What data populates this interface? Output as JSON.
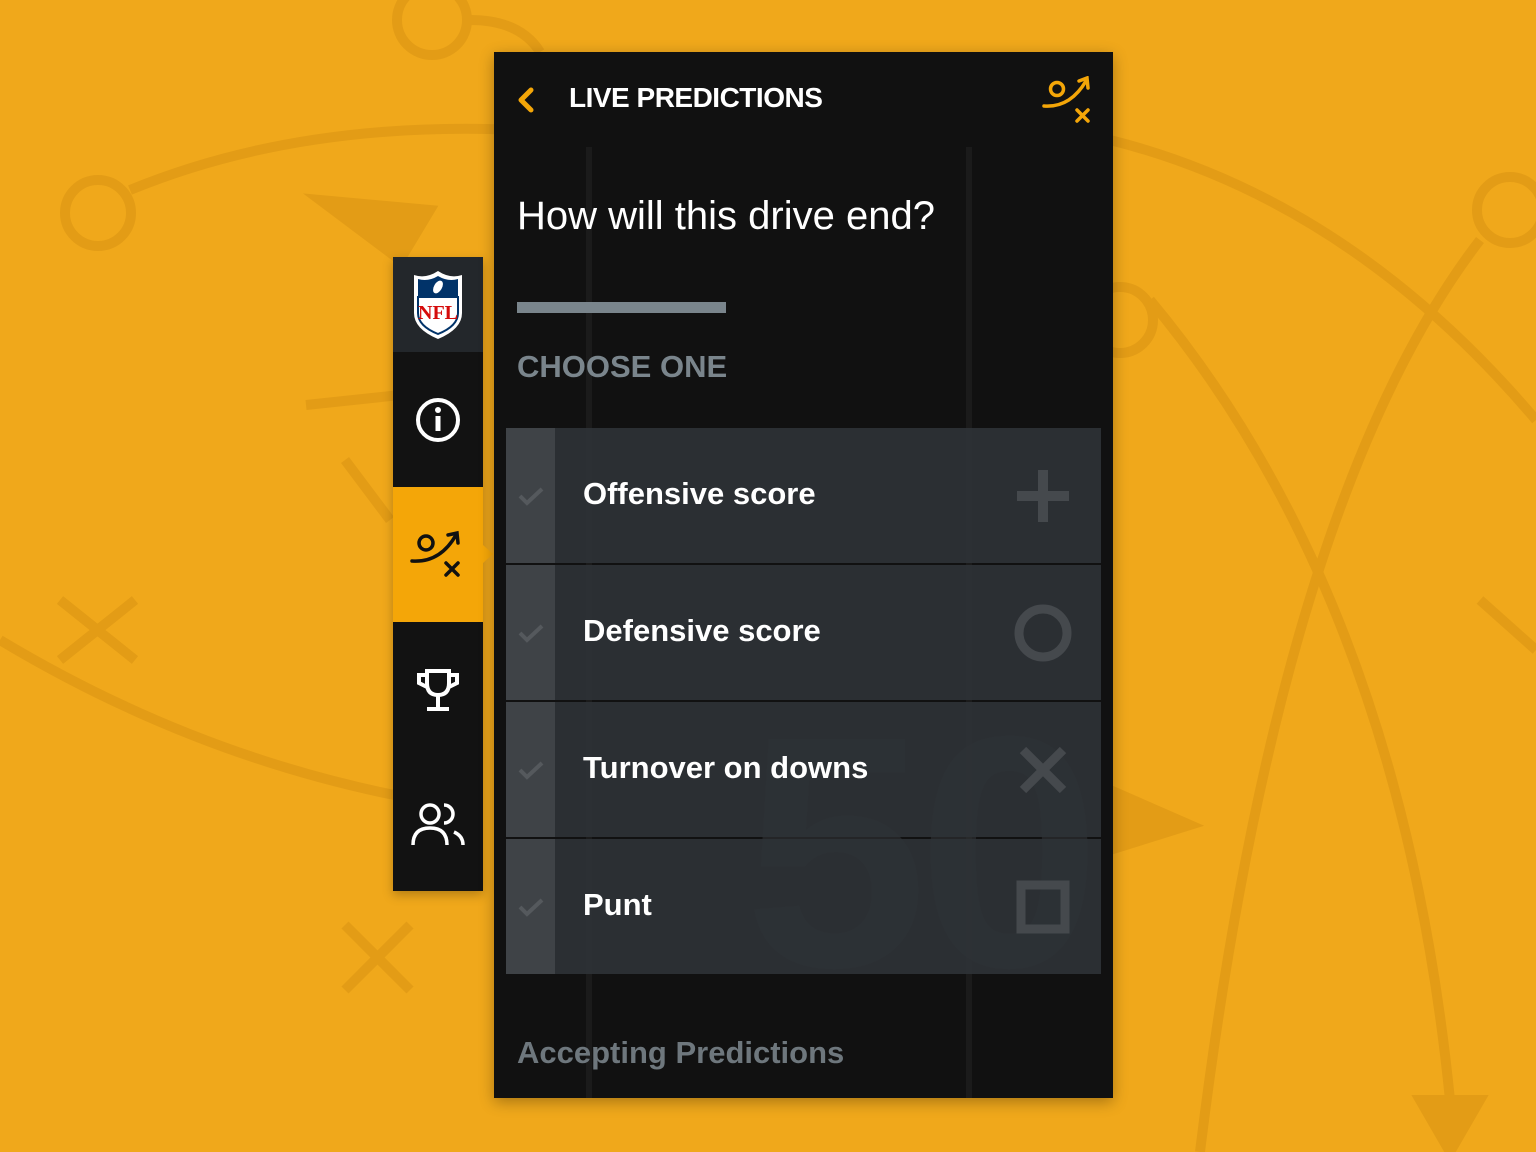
{
  "header": {
    "title": "LIVE PREDICTIONS",
    "back_icon": "chevron-left-icon",
    "action_icon": "playbook-icon"
  },
  "question": "How will this drive end?",
  "progress": 0.35,
  "choose_label": "CHOOSE ONE",
  "options": [
    {
      "label": "Offensive score",
      "icon": "plus-icon"
    },
    {
      "label": "Defensive score",
      "icon": "circle-icon"
    },
    {
      "label": "Turnover on downs",
      "icon": "x-icon"
    },
    {
      "label": "Punt",
      "icon": "square-icon"
    }
  ],
  "status": "Accepting Predictions",
  "sidebar": {
    "items": [
      "nfl-logo",
      "info",
      "predictions",
      "trophy",
      "friends"
    ],
    "active": "predictions"
  },
  "logo_text": "NFL",
  "colors": {
    "accent": "#f4a608",
    "background": "#f0a81b",
    "panel": "#111111",
    "option": "#2e3236"
  }
}
